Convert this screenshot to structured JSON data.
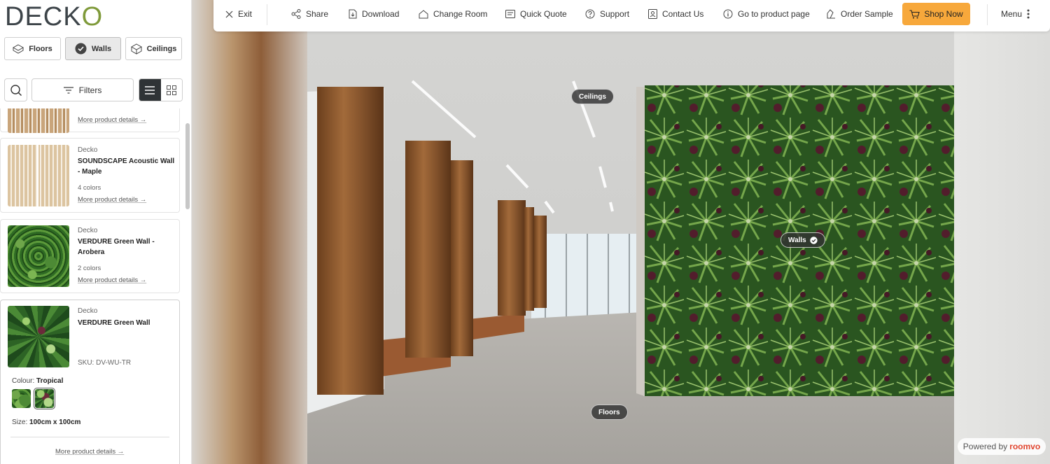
{
  "brand": {
    "logo_text_a": "DECK",
    "logo_text_b": "O"
  },
  "categories": [
    {
      "label": "Floors",
      "icon": "floor-icon",
      "active": false
    },
    {
      "label": "Walls",
      "icon": "check-circle-icon",
      "active": true
    },
    {
      "label": "Ceilings",
      "icon": "ceiling-icon",
      "active": false
    }
  ],
  "tools": {
    "filters_label": "Filters"
  },
  "products": [
    {
      "brand": "",
      "name": "",
      "colors": "",
      "more": "More product details →"
    },
    {
      "brand": "Decko",
      "name": "SOUNDSCAPE Acoustic Wall - Maple",
      "colors": "4 colors",
      "more": "More product details →"
    },
    {
      "brand": "Decko",
      "name": "VERDURE Green Wall - Arobera",
      "colors": "2 colors",
      "more": "More product details →"
    },
    {
      "brand": "Decko",
      "name": "VERDURE Green Wall",
      "sku": "SKU: DV-WU-TR",
      "colour_label": "Colour:",
      "colour_value": "Tropical",
      "size_label": "Size:",
      "size_value": "100cm x 100cm",
      "more": "More product details →"
    }
  ],
  "toolbar": {
    "exit": "Exit",
    "share": "Share",
    "download": "Download",
    "change_room": "Change Room",
    "quick_quote": "Quick Quote",
    "support": "Support",
    "contact": "Contact Us",
    "product_page": "Go to product page",
    "order_sample": "Order Sample",
    "shop_now": "Shop Now",
    "menu": "Menu"
  },
  "hotspots": {
    "ceilings": "Ceilings",
    "walls": "Walls",
    "floors": "Floors"
  },
  "powered": {
    "prefix": "Powered by",
    "brand": "roomvo"
  },
  "colors": {
    "accent": "#f7a83b",
    "logo_o": "#7f9a3a",
    "dark": "#2f3336"
  }
}
